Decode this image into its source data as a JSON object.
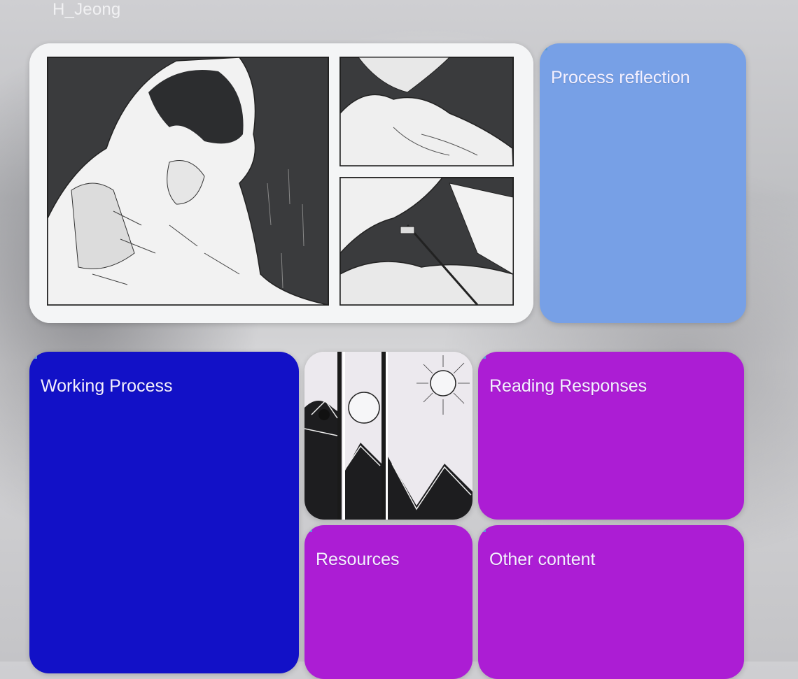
{
  "site": {
    "title": "H_Jeong"
  },
  "tiles": {
    "comic": {
      "alt": ""
    },
    "process_reflection": {
      "label": "Process reflection",
      "color": "#77a0e6"
    },
    "working_process": {
      "label": "Working Process",
      "color": "#1211c7"
    },
    "sun_artwork": {
      "alt": ""
    },
    "reading_responses": {
      "label": "Reading Responses",
      "color": "#ac1dd4"
    },
    "resources": {
      "label": "Resources",
      "color": "#ac1dd4"
    },
    "other_content": {
      "label": "Other content",
      "color": "#ac1dd4"
    }
  }
}
